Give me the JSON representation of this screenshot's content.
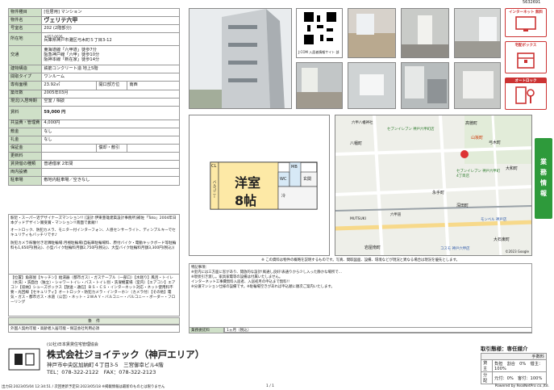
{
  "ref_number": "5632691",
  "spec": {
    "type_label": "物件種目",
    "type_value": "[住居用] マンション",
    "name_label": "物件名",
    "name_value": "ヴェリテ六甲",
    "room_label": "号室名",
    "room_value": "202 (2階部分)",
    "addr_label": "所在地",
    "addr_zip": "〒657-0026",
    "addr_value": "兵庫県神戸市灘区弓木町５丁目3-12",
    "traffic_label": "交通",
    "traffic": [
      "東海道線「六甲道」徒歩7分",
      "阪急神戸線「六甲」徒歩10分",
      "阪神本線「新在家」徒歩14分"
    ],
    "struct_label": "建物構造",
    "struct_value": "鉄筋コンクリート造 地上5階",
    "plan_label": "間取タイプ",
    "plan_value": "ワンルーム",
    "area_label": "専有面積",
    "area_value": "23.92㎡",
    "window_label": "開口部方位",
    "window_value": "南西",
    "built_label": "築年数",
    "built_value": "2005年03月",
    "move_label": "現況/入居時期",
    "move_value": "空室 / 相談",
    "rent_label": "賃料",
    "rent_value": "59,000 円",
    "mgmt_label": "共益費・管理費",
    "mgmt_value": "4,000円",
    "deposit_label": "敷金",
    "deposit_value": "なし",
    "key_label": "礼金",
    "key_value": "なし",
    "guar_label": "保証金",
    "guar_value": "",
    "amort_label": "償却・敷引",
    "amort_value": "",
    "renew_label": "更新料",
    "renew_value": "",
    "lease_label": "賃貸借の種類",
    "lease_value": "普通借家 2年間",
    "cond_label": "両内設備",
    "cond_value": "",
    "parking_label": "駐車場",
    "parking_value": "敷地内駐車場／空きなし"
  },
  "notes": {
    "n1": "駅近・スーパー近デザイナーズマンション!! [設計:伊東豊雄建築設計事務所]補佐「Toto」2004年日本グッドデザイン賞受賞・マンション!!南面で素敵!!",
    "n2": "オートロック、防犯カメラ、モニター付インターフォン、人感センサーライト、ディンプルキーでセキュリティもバッチリです♪",
    "n3": "防犯カメラ稼働付き近隣駐輪場:月極駐輪場(自転車駐輪場料、原付バイク・電動キックボード等駐輪料も1,650円(税込)、小型バイク駐輪料月額2,750円(税込)、大型バイク駐輪料月額3,300円(税込))",
    "facilities": "【位置】角部屋【キッチン】給湯器（都市ガス）・ガステーブル（一部口）【水廻り】風呂・トイレ（水洗）・洗面台（独立）・シャワートイレ・バス・トイレ別・洗濯機置場（室内）【エアコン】エアコン【収納】シューズボックス【放送・通信】ＢＳ・ＣＳ・インターネット対応・ネット使用料不要・光回線【セキュリティ】オートロック・防犯カメラ・インターホン（カメラ付）【その他】電気・ガス・都市ガス・水道（公営）・ネット・２ＷＡＹ・バルコニー・バルコニー・ボーダー・フローリング",
    "cond_section": "条　件",
    "cond_text": "外国人契約可能・高齢者入居可能・保証会社利用必須"
  },
  "qr_caption": "J:COM 入居者情報サイト 部",
  "floorplan": {
    "title": "洋室",
    "size": "8帖",
    "labels": [
      "CL",
      "バルコニー",
      "WC",
      "MB",
      "玄関",
      "冷"
    ]
  },
  "map": {
    "labels": [
      "高徳町",
      "山坂町",
      "八幡町",
      "弓木町",
      "大和町",
      "永手町",
      "深田町",
      "大石東町",
      "岩屋南町",
      "セブンイレブン 神戸六甲町店",
      "セブンイレブン 神戸六甲町4丁目店",
      "六甲八幡神社",
      "コスモ 神戸六甲店",
      "モンベル 神戸店",
      "六甲道",
      "MUTSUKI"
    ],
    "copyright": "©2023 Google"
  },
  "map_note": "※ この資料は物件の概略を説明するものです。写真、間取図面、設備、環境などが現況と異なる場合は現況を優先とします。",
  "remarks_label": "特記事項：",
  "remarks": [
    "※室内には三方面に窓があり、開放的な設計!風通し良好!表通りから少し入った静かな場所で…",
    "※現状引き渡し。家具家電等の設備は付属いたしません。",
    "インターネット工事費無料入居者、入居初月の申込まで無料!!",
    "※分譲マンション仕様の設備です。※駐輪場空きがあれば申込順に順次ご案内いたします。"
  ],
  "fee_row": {
    "label": "業務委託料",
    "value": "1ヵ月（税込）"
  },
  "company": {
    "assoc": "(公社)日本賃貸住宅管理協会",
    "name": "株式会社ジョイテック（神戸エリア）",
    "address": "神戸市中央区加納町４丁目3-5　三宮御幸ビル4階",
    "phone": "TEL：078-322-2122　FAX：078-322-2123"
  },
  "trade": {
    "title": "取引態様：専任媒介",
    "fee_header": "手数料",
    "rows": [
      {
        "party": "貸主",
        "value": "負担　割合　0%　借主：100%"
      },
      {
        "party": "分配",
        "value": "元付：0%　客付：100%"
      }
    ]
  },
  "icons": {
    "net_label": "インターネット 無料",
    "box_label": "宅配ボックス",
    "lock_label": "オートロック"
  },
  "side_tab": [
    "業",
    "務",
    "情",
    "報"
  ],
  "footer_left": "出力日:2023/05/04 12:34:51 / 次回更新予定日:2023/05/18 ※掲載情報は最新のものとは限りません",
  "footer_page": "1 / 1",
  "footer_right": "Powered by RealNetPro co.,ltd."
}
